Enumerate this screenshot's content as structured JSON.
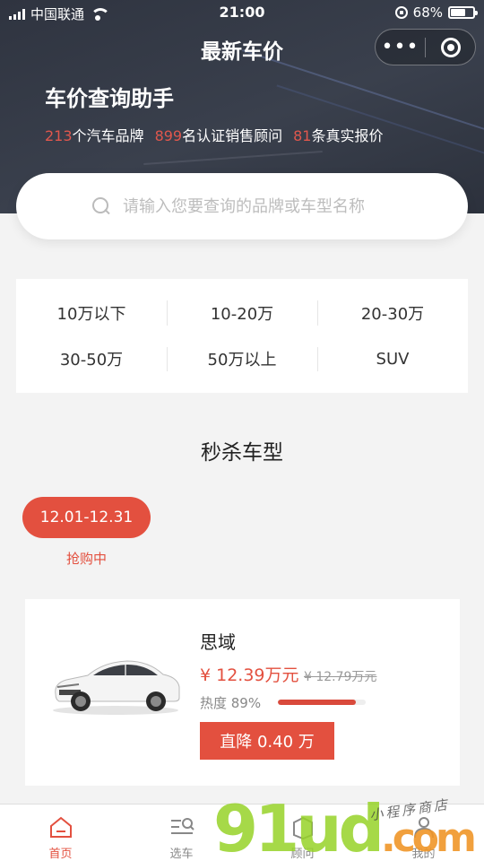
{
  "status_bar": {
    "carrier": "中国联通",
    "time": "21:00",
    "battery": "68%",
    "battery_level": 0.68
  },
  "nav": {
    "title": "最新车价",
    "more_icon": "•••"
  },
  "hero": {
    "title": "车价查询助手",
    "stats": [
      {
        "num": "213",
        "text": "个汽车品牌"
      },
      {
        "num": "899",
        "text": "名认证销售顾问"
      },
      {
        "num": "81",
        "text": "条真实报价"
      }
    ]
  },
  "search": {
    "placeholder": "请输入您要查询的品牌或车型名称"
  },
  "price_ranges": [
    "10万以下",
    "10-20万",
    "20-30万",
    "30-50万",
    "50万以上",
    "SUV"
  ],
  "flash_sale": {
    "title": "秒杀车型",
    "date_range": "12.01-12.31",
    "status": "抢购中"
  },
  "car": {
    "name": "思域",
    "price": "¥ 12.39万元",
    "old_price": "¥ 12.79万元",
    "heat_label": "热度 89%",
    "heat": 0.89,
    "drop_button": "直降 0.40 万"
  },
  "tabbar": [
    {
      "label": "首页",
      "icon": "home-icon",
      "active": true
    },
    {
      "label": "选车",
      "icon": "car-search-icon",
      "active": false
    },
    {
      "label": "顾问",
      "icon": "advisor-icon",
      "active": false
    },
    {
      "label": "我的",
      "icon": "user-icon",
      "active": false
    }
  ],
  "watermark": {
    "logo": "91ud.com",
    "caption": "小程序商店"
  },
  "colors": {
    "accent": "#e3503f",
    "header_bg": "#343a46"
  }
}
